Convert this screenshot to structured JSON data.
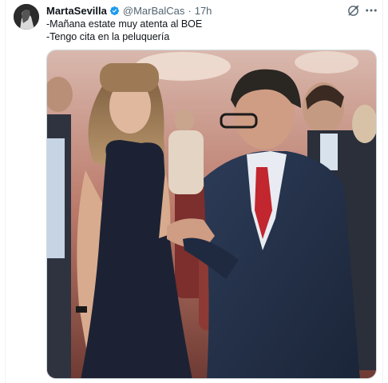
{
  "author": {
    "display_name": "MartaSevilla",
    "handle": "@MarBalCas",
    "separator": "·",
    "time": "17h",
    "verified": true
  },
  "icons": {
    "verified": "verified-badge-icon",
    "grok": "grok-icon",
    "more": "more-options-icon"
  },
  "tweet": {
    "line1": "-Mañana estate muy atenta al BOE",
    "line2": "-Tengo cita en la peluquería"
  },
  "colors": {
    "verified_blue": "#1d9bf0",
    "text_primary": "#0f1419",
    "text_secondary": "#536471",
    "border": "#cfd9de"
  }
}
